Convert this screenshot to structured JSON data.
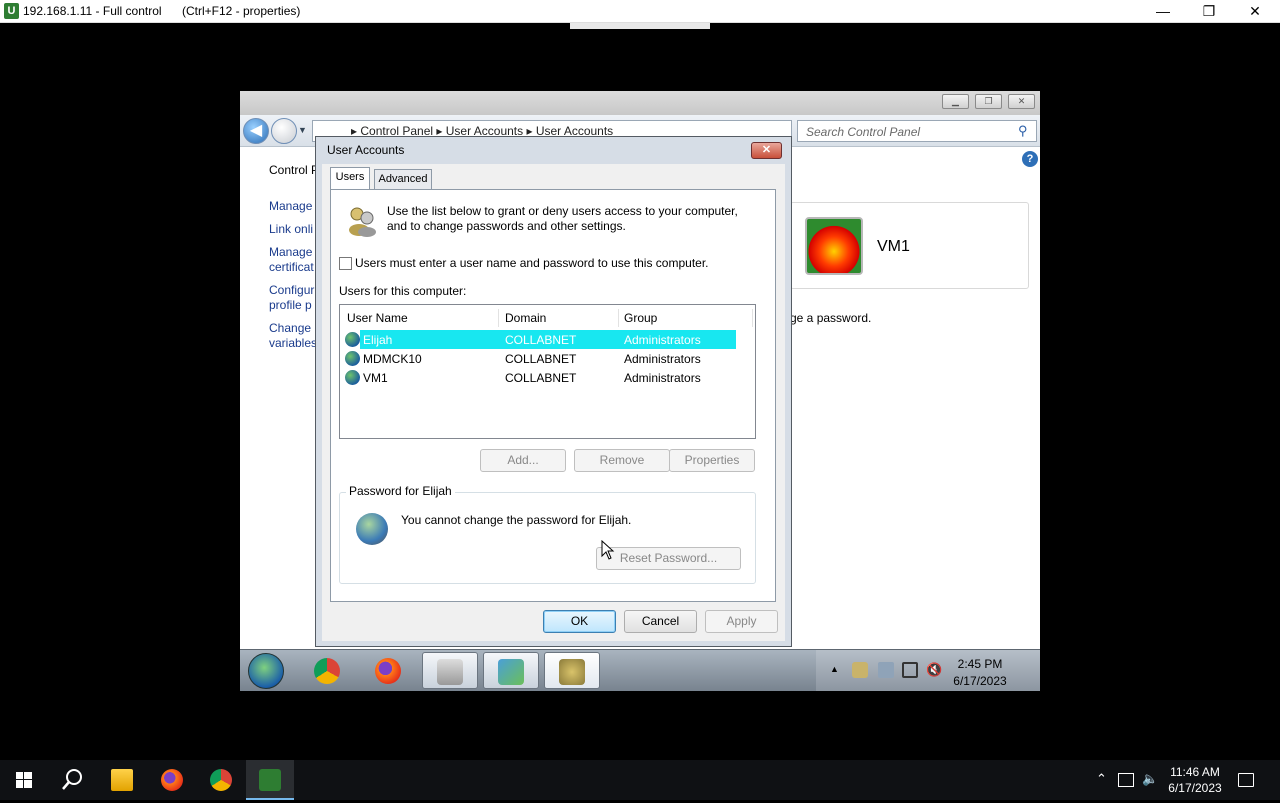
{
  "remote_titlebar": {
    "host": "192.168.1.11",
    "mode": "- Full control",
    "hint": "(Ctrl+F12 - properties)",
    "min": "—",
    "restore": "❐",
    "close": "✕"
  },
  "cp_window": {
    "address": "▸  Control Panel  ▸  User Accounts  ▸  User Accounts",
    "search_placeholder": "Search Control Panel",
    "help": "?",
    "left_links": [
      "Control P",
      "Manage",
      "Link onli",
      "Manage",
      "certificat",
      "Configur",
      "profile p",
      "Change",
      "variables"
    ],
    "vm_name": "VM1",
    "password_text": "ge a password."
  },
  "dialog": {
    "title": "User Accounts",
    "close": "✕",
    "tabs": [
      "Users",
      "Advanced"
    ],
    "intro_line1": "Use the list below to grant or deny users access to your computer,",
    "intro_line2": "and to change passwords and other settings.",
    "checkbox_label": "Users must enter a user name and password to use this computer.",
    "checkbox_checked": false,
    "users_label": "Users for this computer:",
    "columns": [
      "User Name",
      "Domain",
      "Group"
    ],
    "users": [
      {
        "name": "Elijah",
        "domain": "COLLABNET",
        "group": "Administrators",
        "selected": true
      },
      {
        "name": "MDMCK10",
        "domain": "COLLABNET",
        "group": "Administrators",
        "selected": false
      },
      {
        "name": "VM1",
        "domain": "COLLABNET",
        "group": "Administrators",
        "selected": false
      }
    ],
    "add_label": "Add...",
    "remove_label": "Remove",
    "properties_label": "Properties",
    "password_group_title": "Password for Elijah",
    "password_message": "You cannot change the password for Elijah.",
    "reset_label": "Reset Password...",
    "ok_label": "OK",
    "cancel_label": "Cancel",
    "apply_label": "Apply"
  },
  "remote_taskbar": {
    "time": "2:45 PM",
    "date": "6/17/2023",
    "tray_arrow": "▲"
  },
  "host_taskbar": {
    "time": "11:46 AM",
    "date": "6/17/2023",
    "tray_up": "⌃",
    "notif": "🗨"
  },
  "colors": {
    "selection": "#18e7f0",
    "link": "#1a3b8c"
  }
}
